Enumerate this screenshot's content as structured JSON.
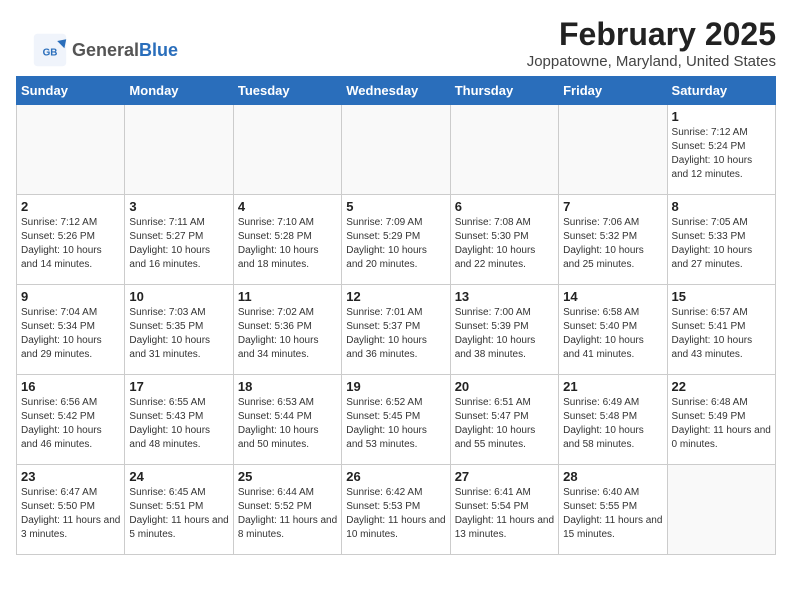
{
  "app": {
    "logo_general": "General",
    "logo_blue": "Blue"
  },
  "header": {
    "month_year": "February 2025",
    "location": "Joppatowne, Maryland, United States"
  },
  "calendar": {
    "days_of_week": [
      "Sunday",
      "Monday",
      "Tuesday",
      "Wednesday",
      "Thursday",
      "Friday",
      "Saturday"
    ],
    "weeks": [
      [
        {
          "day": "",
          "info": ""
        },
        {
          "day": "",
          "info": ""
        },
        {
          "day": "",
          "info": ""
        },
        {
          "day": "",
          "info": ""
        },
        {
          "day": "",
          "info": ""
        },
        {
          "day": "",
          "info": ""
        },
        {
          "day": "1",
          "info": "Sunrise: 7:12 AM\nSunset: 5:24 PM\nDaylight: 10 hours\nand 12 minutes."
        }
      ],
      [
        {
          "day": "2",
          "info": "Sunrise: 7:12 AM\nSunset: 5:26 PM\nDaylight: 10 hours\nand 14 minutes."
        },
        {
          "day": "3",
          "info": "Sunrise: 7:11 AM\nSunset: 5:27 PM\nDaylight: 10 hours\nand 16 minutes."
        },
        {
          "day": "4",
          "info": "Sunrise: 7:10 AM\nSunset: 5:28 PM\nDaylight: 10 hours\nand 18 minutes."
        },
        {
          "day": "5",
          "info": "Sunrise: 7:09 AM\nSunset: 5:29 PM\nDaylight: 10 hours\nand 20 minutes."
        },
        {
          "day": "6",
          "info": "Sunrise: 7:08 AM\nSunset: 5:30 PM\nDaylight: 10 hours\nand 22 minutes."
        },
        {
          "day": "7",
          "info": "Sunrise: 7:06 AM\nSunset: 5:32 PM\nDaylight: 10 hours\nand 25 minutes."
        },
        {
          "day": "8",
          "info": "Sunrise: 7:05 AM\nSunset: 5:33 PM\nDaylight: 10 hours\nand 27 minutes."
        }
      ],
      [
        {
          "day": "9",
          "info": "Sunrise: 7:04 AM\nSunset: 5:34 PM\nDaylight: 10 hours\nand 29 minutes."
        },
        {
          "day": "10",
          "info": "Sunrise: 7:03 AM\nSunset: 5:35 PM\nDaylight: 10 hours\nand 31 minutes."
        },
        {
          "day": "11",
          "info": "Sunrise: 7:02 AM\nSunset: 5:36 PM\nDaylight: 10 hours\nand 34 minutes."
        },
        {
          "day": "12",
          "info": "Sunrise: 7:01 AM\nSunset: 5:37 PM\nDaylight: 10 hours\nand 36 minutes."
        },
        {
          "day": "13",
          "info": "Sunrise: 7:00 AM\nSunset: 5:39 PM\nDaylight: 10 hours\nand 38 minutes."
        },
        {
          "day": "14",
          "info": "Sunrise: 6:58 AM\nSunset: 5:40 PM\nDaylight: 10 hours\nand 41 minutes."
        },
        {
          "day": "15",
          "info": "Sunrise: 6:57 AM\nSunset: 5:41 PM\nDaylight: 10 hours\nand 43 minutes."
        }
      ],
      [
        {
          "day": "16",
          "info": "Sunrise: 6:56 AM\nSunset: 5:42 PM\nDaylight: 10 hours\nand 46 minutes."
        },
        {
          "day": "17",
          "info": "Sunrise: 6:55 AM\nSunset: 5:43 PM\nDaylight: 10 hours\nand 48 minutes."
        },
        {
          "day": "18",
          "info": "Sunrise: 6:53 AM\nSunset: 5:44 PM\nDaylight: 10 hours\nand 50 minutes."
        },
        {
          "day": "19",
          "info": "Sunrise: 6:52 AM\nSunset: 5:45 PM\nDaylight: 10 hours\nand 53 minutes."
        },
        {
          "day": "20",
          "info": "Sunrise: 6:51 AM\nSunset: 5:47 PM\nDaylight: 10 hours\nand 55 minutes."
        },
        {
          "day": "21",
          "info": "Sunrise: 6:49 AM\nSunset: 5:48 PM\nDaylight: 10 hours\nand 58 minutes."
        },
        {
          "day": "22",
          "info": "Sunrise: 6:48 AM\nSunset: 5:49 PM\nDaylight: 11 hours\nand 0 minutes."
        }
      ],
      [
        {
          "day": "23",
          "info": "Sunrise: 6:47 AM\nSunset: 5:50 PM\nDaylight: 11 hours\nand 3 minutes."
        },
        {
          "day": "24",
          "info": "Sunrise: 6:45 AM\nSunset: 5:51 PM\nDaylight: 11 hours\nand 5 minutes."
        },
        {
          "day": "25",
          "info": "Sunrise: 6:44 AM\nSunset: 5:52 PM\nDaylight: 11 hours\nand 8 minutes."
        },
        {
          "day": "26",
          "info": "Sunrise: 6:42 AM\nSunset: 5:53 PM\nDaylight: 11 hours\nand 10 minutes."
        },
        {
          "day": "27",
          "info": "Sunrise: 6:41 AM\nSunset: 5:54 PM\nDaylight: 11 hours\nand 13 minutes."
        },
        {
          "day": "28",
          "info": "Sunrise: 6:40 AM\nSunset: 5:55 PM\nDaylight: 11 hours\nand 15 minutes."
        },
        {
          "day": "",
          "info": ""
        }
      ]
    ]
  }
}
